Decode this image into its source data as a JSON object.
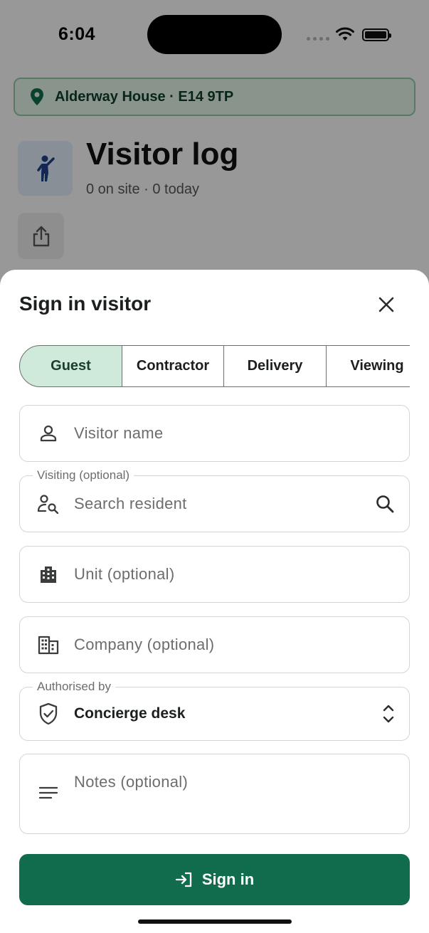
{
  "status": {
    "time": "6:04"
  },
  "background": {
    "location": "Alderway House · E14 9TP",
    "title": "Visitor log",
    "subtitle": "0 on site · 0 today"
  },
  "sheet": {
    "title": "Sign in visitor",
    "tabs": [
      {
        "label": "Guest",
        "active": true
      },
      {
        "label": "Contractor",
        "active": false
      },
      {
        "label": "Delivery",
        "active": false
      },
      {
        "label": "Viewing",
        "active": false
      }
    ],
    "fields": {
      "visitor_name": {
        "placeholder": "Visitor name"
      },
      "visiting": {
        "label": "Visiting (optional)",
        "placeholder": "Search resident"
      },
      "unit": {
        "placeholder": "Unit (optional)"
      },
      "company": {
        "placeholder": "Company (optional)"
      },
      "authorised_by": {
        "label": "Authorised by",
        "value": "Concierge desk"
      },
      "notes": {
        "placeholder": "Notes (optional)"
      }
    },
    "submit_label": "Sign in"
  },
  "colors": {
    "accent": "#116b4d",
    "active_tab_bg": "#cfe9da",
    "location_bg": "#dcefe3"
  },
  "icons": [
    "location-pin-icon",
    "person-waving-icon",
    "share-icon",
    "close-icon",
    "person-icon",
    "person-search-icon",
    "search-icon",
    "apartment-icon",
    "office-building-icon",
    "shield-check-icon",
    "chevron-up-down-icon",
    "notes-lines-icon",
    "login-arrow-icon"
  ]
}
